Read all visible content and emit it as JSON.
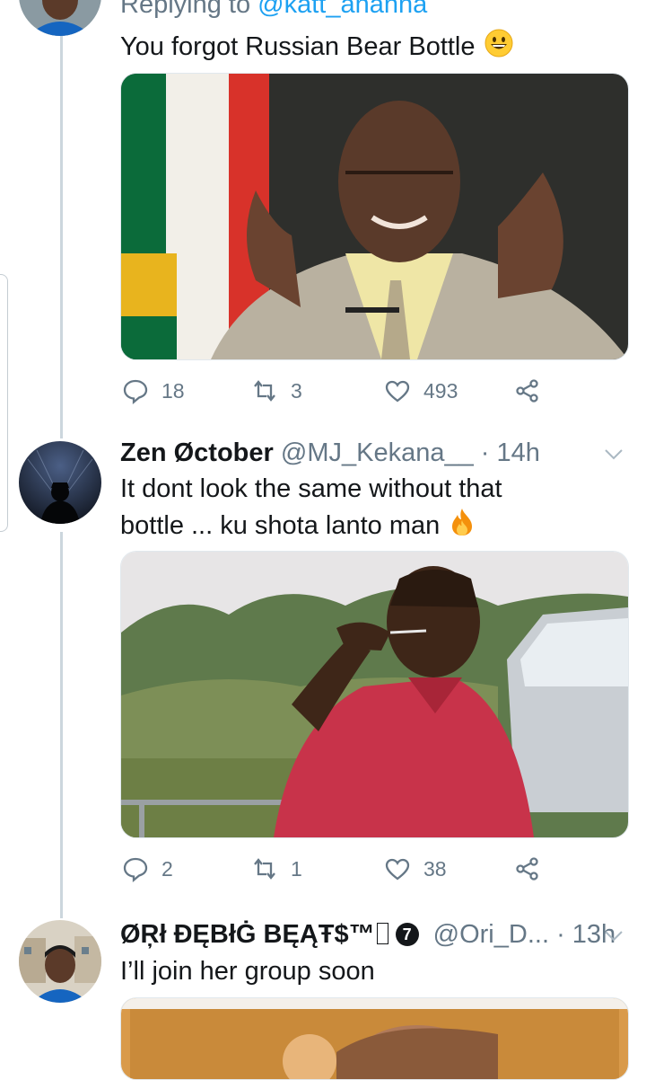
{
  "tweet1": {
    "replying_to_prefix": "Replying to",
    "replying_to_handle": "@katt_ananna",
    "text": "You forgot  Russian Bear Bottle",
    "emoji": "grinning-face",
    "actions": {
      "replies": "18",
      "retweets": "3",
      "likes": "493"
    }
  },
  "tweet2": {
    "name": "Zen Øctober",
    "handle": "@MJ_Kekana__",
    "time": "· 14h",
    "text_line1": "It dont look the same without that",
    "text_line2": "bottle  ... ku shota lanto man",
    "emoji": "fire",
    "actions": {
      "replies": "2",
      "retweets": "1",
      "likes": "38"
    }
  },
  "tweet3": {
    "name": "ØŖł ĐĘBłĠ BĘĄŦ$™",
    "badge": "7",
    "handle": "@Ori_D...",
    "time": "· 13h",
    "text": "I’ll join her group soon"
  },
  "colors": {
    "accent": "#1da1f2",
    "muted": "#657786",
    "line": "#ccd6dd"
  }
}
